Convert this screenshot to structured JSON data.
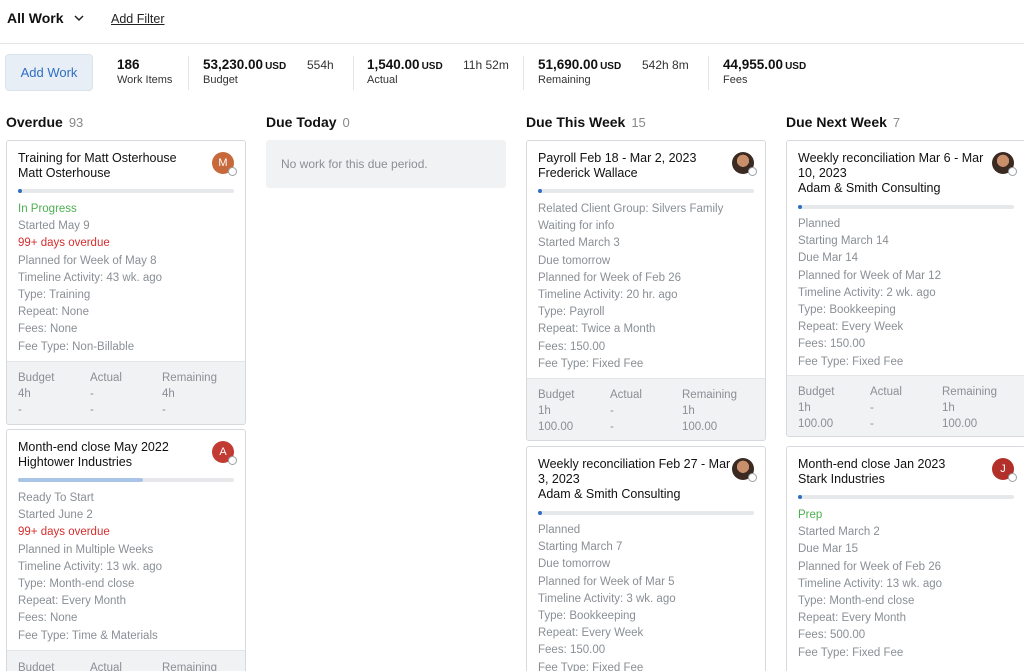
{
  "header": {
    "view_label": "All Work",
    "add_filter": "Add Filter"
  },
  "summary": {
    "add_work": "Add Work",
    "work_items": {
      "value": "186",
      "caption": "Work Items"
    },
    "budget": {
      "value": "53,230.00",
      "unit": "USD",
      "hours": "554h",
      "caption": "Budget"
    },
    "actual": {
      "value": "1,540.00",
      "unit": "USD",
      "hours": "11h 52m",
      "caption": "Actual"
    },
    "remaining": {
      "value": "51,690.00",
      "unit": "USD",
      "hours": "542h 8m",
      "caption": "Remaining"
    },
    "fees": {
      "value": "44,955.00",
      "unit": "USD",
      "caption": "Fees"
    }
  },
  "columns": [
    {
      "title": "Overdue",
      "count": "93",
      "cards": [
        {
          "title": "Training for Matt Osterhouse",
          "client": "Matt Osterhouse",
          "avatar": {
            "initial": "M",
            "color": "#c8693c"
          },
          "progress": 0.02,
          "status": "In Progress",
          "started": "Started May 9",
          "overdue": "99+ days overdue",
          "planned": "Planned for Week of May 8",
          "timeline": "Timeline Activity: 43 wk. ago",
          "type": "Type: Training",
          "repeat": "Repeat: None",
          "fees": "Fees: None",
          "fee_type": "Fee Type: Non-Billable",
          "footer": {
            "budget_label": "Budget",
            "actual_label": "Actual",
            "remaining_label": "Remaining",
            "budget_hours": "4h",
            "actual_hours": "-",
            "remaining_hours": "4h",
            "budget_amount": "-",
            "actual_amount": "-",
            "remaining_amount": "-"
          }
        },
        {
          "title": "Month-end close May 2022",
          "client": "Hightower Industries",
          "avatar": {
            "initial": "A",
            "color": "#c23b32"
          },
          "progress": 0.58,
          "status": "Ready To Start",
          "started": "Started June 2",
          "overdue": "99+ days overdue",
          "planned": "Planned in Multiple Weeks",
          "timeline": "Timeline Activity: 13 wk. ago",
          "type": "Type: Month-end close",
          "repeat": "Repeat: Every Month",
          "fees": "Fees: None",
          "fee_type": "Fee Type: Time & Materials",
          "footer": {
            "budget_label": "Budget",
            "actual_label": "Actual",
            "remaining_label": "Remaining"
          }
        }
      ]
    },
    {
      "title": "Due Today",
      "count": "0",
      "empty_text": "No work for this due period."
    },
    {
      "title": "Due This Week",
      "count": "15",
      "cards": [
        {
          "title": "Payroll Feb 18 - Mar 2, 2023",
          "client": "Frederick Wallace",
          "progress": 0.01,
          "related": "Related Client Group: Silvers Family",
          "status": "Waiting for info",
          "started": "Started March 3",
          "due": "Due tomorrow",
          "planned": "Planned for Week of Feb 26",
          "timeline": "Timeline Activity: 20 hr. ago",
          "type": "Type: Payroll",
          "repeat": "Repeat: Twice a Month",
          "fees": "Fees: 150.00",
          "fee_type": "Fee Type: Fixed Fee",
          "footer": {
            "budget_label": "Budget",
            "actual_label": "Actual",
            "remaining_label": "Remaining",
            "budget_hours": "1h",
            "actual_hours": "-",
            "remaining_hours": "1h",
            "budget_amount": "100.00",
            "actual_amount": "-",
            "remaining_amount": "100.00"
          }
        },
        {
          "title": "Weekly reconciliation Feb 27 - Mar 3, 2023",
          "client": "Adam & Smith Consulting",
          "progress": 0.01,
          "status": "Planned",
          "started": "Starting March 7",
          "due": "Due tomorrow",
          "planned": "Planned for Week of Mar 5",
          "timeline": "Timeline Activity: 3 wk. ago",
          "type": "Type: Bookkeeping",
          "repeat": "Repeat: Every Week",
          "fees": "Fees: 150.00",
          "fee_type": "Fee Type: Fixed Fee"
        }
      ]
    },
    {
      "title": "Due Next Week",
      "count": "7",
      "cards": [
        {
          "title": "Weekly reconciliation Mar 6 - Mar 10, 2023",
          "client": "Adam & Smith Consulting",
          "progress": 0.01,
          "status": "Planned",
          "started": "Starting March 14",
          "due": "Due Mar 14",
          "planned": "Planned for Week of Mar 12",
          "timeline": "Timeline Activity: 2 wk. ago",
          "type": "Type: Bookkeeping",
          "repeat": "Repeat: Every Week",
          "fees": "Fees: 150.00",
          "fee_type": "Fee Type: Fixed Fee",
          "footer": {
            "budget_label": "Budget",
            "actual_label": "Actual",
            "remaining_label": "Remaining",
            "budget_hours": "1h",
            "actual_hours": "-",
            "remaining_hours": "1h",
            "budget_amount": "100.00",
            "actual_amount": "-",
            "remaining_amount": "100.00"
          }
        },
        {
          "title": "Month-end close Jan 2023",
          "client": "Stark Industries",
          "avatar": {
            "initial": "J",
            "color": "#b3302a"
          },
          "progress": 0.01,
          "status": "Prep",
          "started": "Started March 2",
          "due": "Due Mar 15",
          "planned": "Planned for Week of Feb 26",
          "timeline": "Timeline Activity: 13 wk. ago",
          "type": "Type: Month-end close",
          "repeat": "Repeat: Every Month",
          "fees": "Fees: 500.00",
          "fee_type": "Fee Type: Fixed Fee"
        }
      ]
    }
  ],
  "colors": {
    "accent": "#2e6fc2",
    "in_progress": "#4caf50",
    "overdue": "#d32f2f"
  }
}
